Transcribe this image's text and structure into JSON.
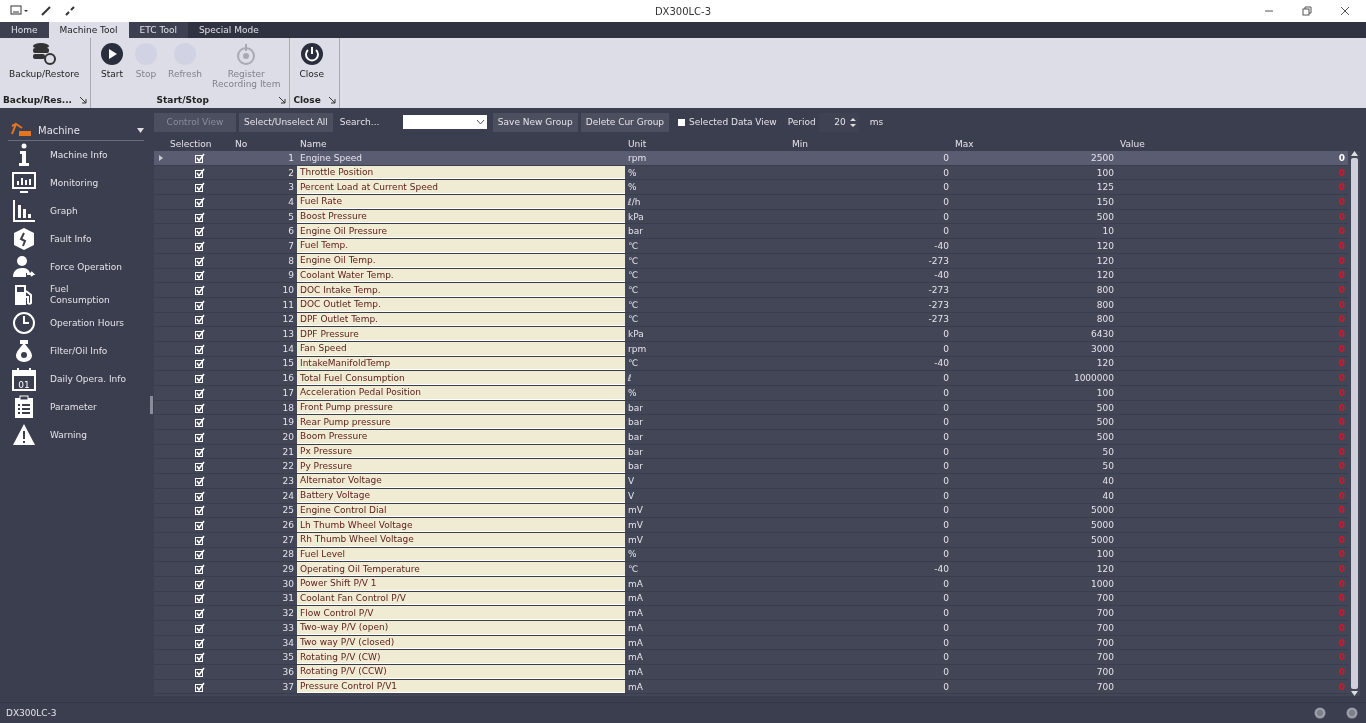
{
  "window": {
    "title": "DX300LC-3"
  },
  "ribbon_tabs": [
    {
      "label": "Home",
      "selected": false
    },
    {
      "label": "Machine Tool",
      "selected": true
    },
    {
      "label": "ETC Tool",
      "selected": false
    },
    {
      "label": "Special Mode",
      "selected": false
    }
  ],
  "ribbon_groups": [
    {
      "label": "Backup/Res...",
      "items": [
        {
          "label": "Backup/Restore",
          "kind": "backup",
          "disabled": false
        }
      ]
    },
    {
      "label": "Start/Stop",
      "items": [
        {
          "label": "Start",
          "kind": "play",
          "disabled": false
        },
        {
          "label": "Stop",
          "kind": "blank",
          "disabled": true
        },
        {
          "label": "Refresh",
          "kind": "blank",
          "disabled": true
        },
        {
          "label": "Register\nRecording Item",
          "kind": "record",
          "disabled": true
        }
      ]
    },
    {
      "label": "Close",
      "items": [
        {
          "label": "Close",
          "kind": "power",
          "disabled": false
        }
      ]
    }
  ],
  "sidebar": {
    "header": "Machine",
    "items": [
      {
        "label": "Machine Info",
        "kind": "info"
      },
      {
        "label": "Monitoring",
        "kind": "monitor"
      },
      {
        "label": "Graph",
        "kind": "graph"
      },
      {
        "label": "Fault Info",
        "kind": "fault"
      },
      {
        "label": "Force Operation",
        "kind": "force"
      },
      {
        "label": "Fuel\nConsumption",
        "kind": "fuel"
      },
      {
        "label": "Operation Hours",
        "kind": "clock"
      },
      {
        "label": "Filter/Oil Info",
        "kind": "drop"
      },
      {
        "label": "Daily Opera. Info",
        "kind": "calendar",
        "icon_text": "01"
      },
      {
        "label": "Parameter",
        "kind": "clipboard"
      },
      {
        "label": "Warning",
        "kind": "warning"
      }
    ]
  },
  "toolbar": {
    "control_view": {
      "label": "Control View",
      "disabled": true
    },
    "select_all": "Select/Unselect All",
    "search": {
      "placeholder": "Search..."
    },
    "save_group": "Save New Group",
    "delete_group": "Delete Cur Group",
    "selected_data_view": {
      "label": "Selected Data View",
      "checked": false
    },
    "period_label": "Period",
    "period": "20",
    "period_unit": "ms"
  },
  "table": {
    "columns": [
      "Selection",
      "No",
      "Name",
      "Unit",
      "Min",
      "Max",
      "Value"
    ],
    "rows": [
      {
        "checked": true,
        "no": "1",
        "name": "Engine Speed",
        "unit": "rpm",
        "min": "0",
        "max": "2500",
        "value": "0",
        "selected": true
      },
      {
        "checked": true,
        "no": "2",
        "name": "Throttle Position",
        "unit": "%",
        "min": "0",
        "max": "100",
        "value": "0",
        "selected": false
      },
      {
        "checked": true,
        "no": "3",
        "name": "Percent Load at Current Speed",
        "unit": "%",
        "min": "0",
        "max": "125",
        "value": "0",
        "selected": false
      },
      {
        "checked": true,
        "no": "4",
        "name": "Fuel Rate",
        "unit": "ℓ/h",
        "min": "0",
        "max": "150",
        "value": "0",
        "selected": false
      },
      {
        "checked": true,
        "no": "5",
        "name": "Boost Pressure",
        "unit": "kPa",
        "min": "0",
        "max": "500",
        "value": "0",
        "selected": false
      },
      {
        "checked": true,
        "no": "6",
        "name": "Engine Oil Pressure",
        "unit": "bar",
        "min": "0",
        "max": "10",
        "value": "0",
        "selected": false
      },
      {
        "checked": true,
        "no": "7",
        "name": "Fuel Temp.",
        "unit": "℃",
        "min": "-40",
        "max": "120",
        "value": "0",
        "selected": false
      },
      {
        "checked": true,
        "no": "8",
        "name": "Engine Oil Temp.",
        "unit": "℃",
        "min": "-273",
        "max": "120",
        "value": "0",
        "selected": false
      },
      {
        "checked": true,
        "no": "9",
        "name": "Coolant Water Temp.",
        "unit": "℃",
        "min": "-40",
        "max": "120",
        "value": "0",
        "selected": false
      },
      {
        "checked": true,
        "no": "10",
        "name": "DOC Intake Temp.",
        "unit": "℃",
        "min": "-273",
        "max": "800",
        "value": "0",
        "selected": false
      },
      {
        "checked": true,
        "no": "11",
        "name": "DOC Outlet Temp.",
        "unit": "℃",
        "min": "-273",
        "max": "800",
        "value": "0",
        "selected": false
      },
      {
        "checked": true,
        "no": "12",
        "name": "DPF Outlet Temp.",
        "unit": "℃",
        "min": "-273",
        "max": "800",
        "value": "0",
        "selected": false
      },
      {
        "checked": true,
        "no": "13",
        "name": "DPF Pressure",
        "unit": "kPa",
        "min": "0",
        "max": "6430",
        "value": "0",
        "selected": false
      },
      {
        "checked": true,
        "no": "14",
        "name": "Fan Speed",
        "unit": "rpm",
        "min": "0",
        "max": "3000",
        "value": "0",
        "selected": false
      },
      {
        "checked": true,
        "no": "15",
        "name": "IntakeManifoldTemp",
        "unit": "℃",
        "min": "-40",
        "max": "120",
        "value": "0",
        "selected": false
      },
      {
        "checked": true,
        "no": "16",
        "name": "Total Fuel Consumption",
        "unit": "ℓ",
        "min": "0",
        "max": "1000000",
        "value": "0",
        "selected": false
      },
      {
        "checked": true,
        "no": "17",
        "name": "Acceleration Pedal Position",
        "unit": "%",
        "min": "0",
        "max": "100",
        "value": "0",
        "selected": false
      },
      {
        "checked": true,
        "no": "18",
        "name": "Front Pump pressure",
        "unit": "bar",
        "min": "0",
        "max": "500",
        "value": "0",
        "selected": false
      },
      {
        "checked": true,
        "no": "19",
        "name": "Rear Pump pressure",
        "unit": "bar",
        "min": "0",
        "max": "500",
        "value": "0",
        "selected": false
      },
      {
        "checked": true,
        "no": "20",
        "name": "Boom Pressure",
        "unit": "bar",
        "min": "0",
        "max": "500",
        "value": "0",
        "selected": false
      },
      {
        "checked": true,
        "no": "21",
        "name": "Px Pressure",
        "unit": "bar",
        "min": "0",
        "max": "50",
        "value": "0",
        "selected": false
      },
      {
        "checked": true,
        "no": "22",
        "name": "Py Pressure",
        "unit": "bar",
        "min": "0",
        "max": "50",
        "value": "0",
        "selected": false
      },
      {
        "checked": true,
        "no": "23",
        "name": "Alternator Voltage",
        "unit": "V",
        "min": "0",
        "max": "40",
        "value": "0",
        "selected": false
      },
      {
        "checked": true,
        "no": "24",
        "name": "Battery Voltage",
        "unit": "V",
        "min": "0",
        "max": "40",
        "value": "0",
        "selected": false
      },
      {
        "checked": true,
        "no": "25",
        "name": "Engine Control Dial",
        "unit": "mV",
        "min": "0",
        "max": "5000",
        "value": "0",
        "selected": false
      },
      {
        "checked": true,
        "no": "26",
        "name": "Lh Thumb Wheel Voltage",
        "unit": "mV",
        "min": "0",
        "max": "5000",
        "value": "0",
        "selected": false
      },
      {
        "checked": true,
        "no": "27",
        "name": "Rh Thumb Wheel Voltage",
        "unit": "mV",
        "min": "0",
        "max": "5000",
        "value": "0",
        "selected": false
      },
      {
        "checked": true,
        "no": "28",
        "name": "Fuel Level",
        "unit": "%",
        "min": "0",
        "max": "100",
        "value": "0",
        "selected": false
      },
      {
        "checked": true,
        "no": "29",
        "name": "Operating Oil Temperature",
        "unit": "℃",
        "min": "-40",
        "max": "120",
        "value": "0",
        "selected": false
      },
      {
        "checked": true,
        "no": "30",
        "name": "Power Shift P/V 1",
        "unit": "mA",
        "min": "0",
        "max": "1000",
        "value": "0",
        "selected": false
      },
      {
        "checked": true,
        "no": "31",
        "name": "Coolant Fan Control P/V",
        "unit": "mA",
        "min": "0",
        "max": "700",
        "value": "0",
        "selected": false
      },
      {
        "checked": true,
        "no": "32",
        "name": "Flow Control P/V",
        "unit": "mA",
        "min": "0",
        "max": "700",
        "value": "0",
        "selected": false
      },
      {
        "checked": true,
        "no": "33",
        "name": "Two-way P/V (open)",
        "unit": "mA",
        "min": "0",
        "max": "700",
        "value": "0",
        "selected": false
      },
      {
        "checked": true,
        "no": "34",
        "name": "Two way P/V (closed)",
        "unit": "mA",
        "min": "0",
        "max": "700",
        "value": "0",
        "selected": false
      },
      {
        "checked": true,
        "no": "35",
        "name": "Rotating P/V (CW)",
        "unit": "mA",
        "min": "0",
        "max": "700",
        "value": "0",
        "selected": false
      },
      {
        "checked": true,
        "no": "36",
        "name": "Rotating P/V (CCW)",
        "unit": "mA",
        "min": "0",
        "max": "700",
        "value": "0",
        "selected": false
      },
      {
        "checked": true,
        "no": "37",
        "name": "Pressure Control P/V1",
        "unit": "mA",
        "min": "0",
        "max": "700",
        "value": "0",
        "selected": false
      }
    ]
  },
  "status_bar": {
    "text": "DX300LC-3"
  }
}
